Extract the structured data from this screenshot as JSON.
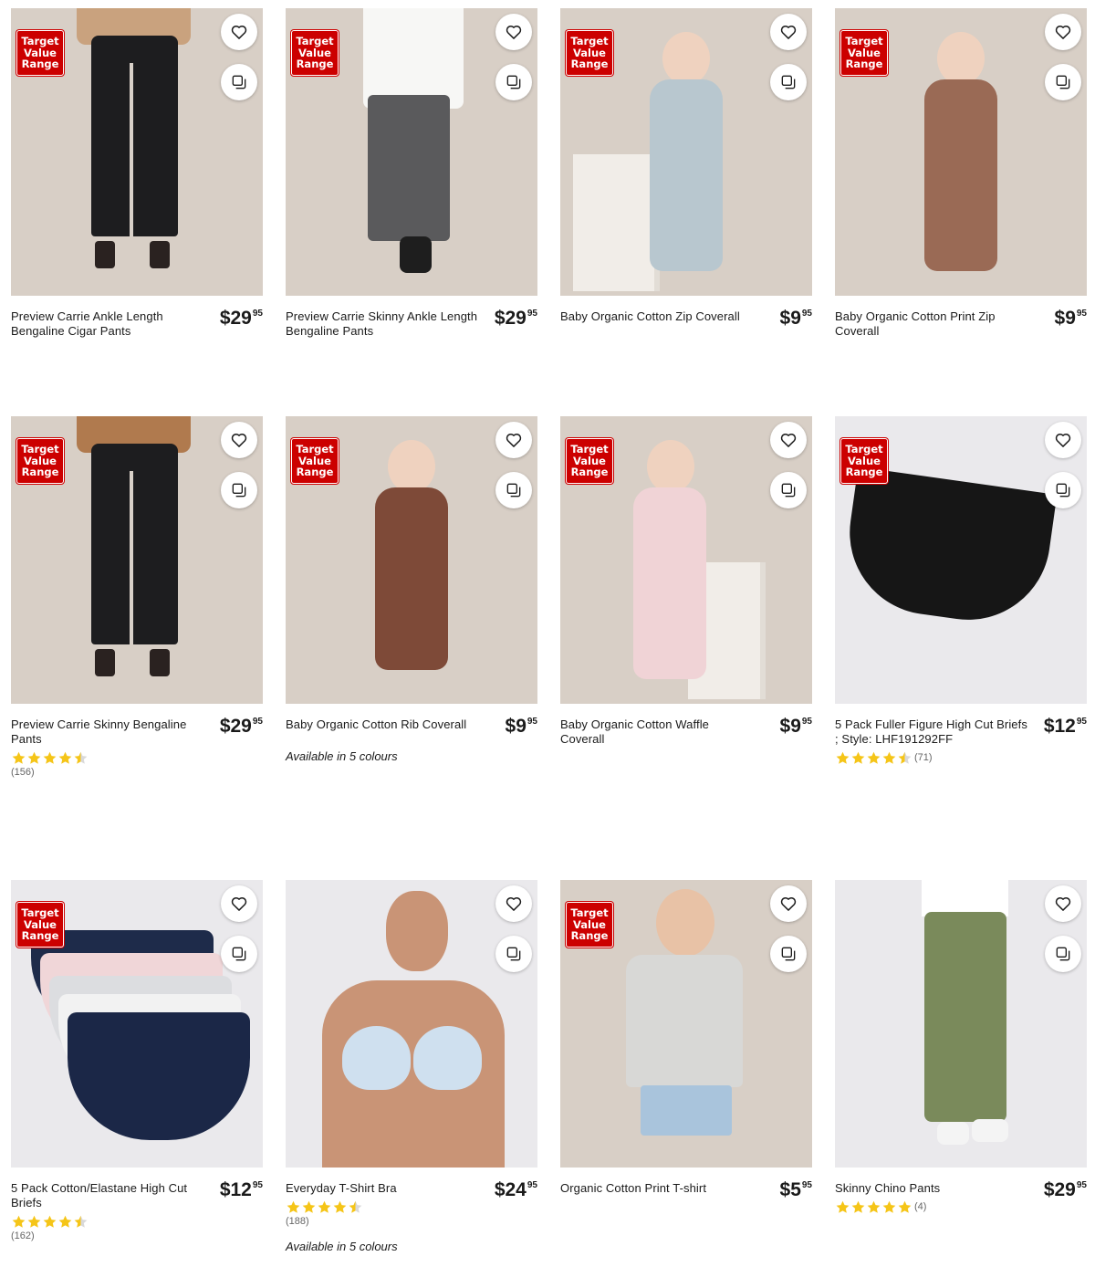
{
  "badge_lines": [
    "Target",
    "Value",
    "Range"
  ],
  "colors": {
    "badge_red": "#cc0000",
    "star_gold": "#f5c518",
    "star_empty": "#d9d9d9"
  },
  "icons": {
    "favourite": "heart-outline-icon",
    "compare": "compare-squares-icon",
    "rating": "star-icon"
  },
  "products": [
    {
      "name": "Preview Carrie Ankle Length Bengaline Cigar Pants",
      "price_dollars": "$29",
      "price_cents": "95",
      "badge": true,
      "rating": null,
      "reviews": null,
      "colours_note": null
    },
    {
      "name": "Preview Carrie Skinny Ankle Length Bengaline Pants",
      "price_dollars": "$29",
      "price_cents": "95",
      "badge": true,
      "rating": null,
      "reviews": null,
      "colours_note": null
    },
    {
      "name": "Baby Organic Cotton Zip Coverall",
      "price_dollars": "$9",
      "price_cents": "95",
      "badge": true,
      "rating": null,
      "reviews": null,
      "colours_note": null
    },
    {
      "name": "Baby Organic Cotton Print Zip Coverall",
      "price_dollars": "$9",
      "price_cents": "95",
      "badge": true,
      "rating": null,
      "reviews": null,
      "colours_note": null
    },
    {
      "name": "Preview Carrie Skinny Bengaline Pants",
      "price_dollars": "$29",
      "price_cents": "95",
      "badge": true,
      "rating": 4.5,
      "reviews": "(156)",
      "colours_note": null
    },
    {
      "name": "Baby Organic Cotton Rib Coverall",
      "price_dollars": "$9",
      "price_cents": "95",
      "badge": true,
      "rating": null,
      "reviews": null,
      "colours_note": "Available in 5 colours"
    },
    {
      "name": "Baby Organic Cotton Waffle Coverall",
      "price_dollars": "$9",
      "price_cents": "95",
      "badge": true,
      "rating": null,
      "reviews": null,
      "colours_note": null
    },
    {
      "name": "5 Pack Fuller Figure High Cut Briefs ; Style: LHF191292FF",
      "price_dollars": "$12",
      "price_cents": "95",
      "badge": true,
      "rating": 4.5,
      "reviews": "(71)",
      "colours_note": null
    },
    {
      "name": "5 Pack Cotton/Elastane High Cut Briefs",
      "price_dollars": "$12",
      "price_cents": "95",
      "badge": true,
      "rating": 4.5,
      "reviews": "(162)",
      "colours_note": null
    },
    {
      "name": "Everyday T-Shirt Bra",
      "price_dollars": "$24",
      "price_cents": "95",
      "badge": false,
      "rating": 4.5,
      "reviews": "(188)",
      "colours_note": "Available in 5 colours"
    },
    {
      "name": "Organic Cotton Print T-shirt",
      "price_dollars": "$5",
      "price_cents": "95",
      "badge": true,
      "rating": null,
      "reviews": null,
      "colours_note": null
    },
    {
      "name": "Skinny Chino Pants",
      "price_dollars": "$29",
      "price_cents": "95",
      "badge": false,
      "rating": 5,
      "reviews": "(4)",
      "colours_note": null
    }
  ]
}
